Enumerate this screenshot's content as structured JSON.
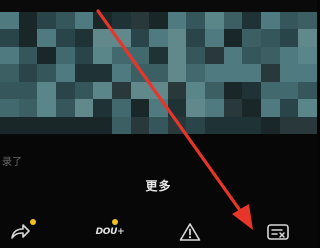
{
  "video": {
    "stray_text": "录了"
  },
  "more_sheet": {
    "title": "更多"
  },
  "actions": {
    "share": {
      "icon": "share-arrow-icon",
      "has_badge": true
    },
    "dou_plus": {
      "label": "DOU+",
      "icon": "dou-plus-icon",
      "has_badge": true
    },
    "report": {
      "icon": "warning-triangle-icon",
      "has_badge": false
    },
    "caption": {
      "icon": "caption-toggle-icon",
      "has_badge": false
    }
  },
  "colors": {
    "badge": "#f2c01e",
    "annotation_arrow": "#e8352a",
    "text": "#e8e8e8",
    "background": "#070707"
  }
}
